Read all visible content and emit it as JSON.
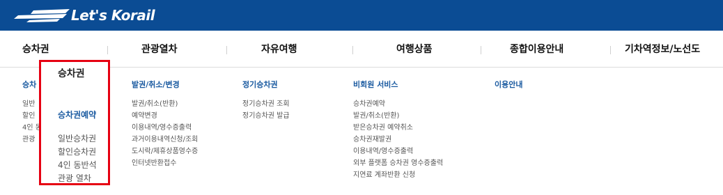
{
  "brand": {
    "logo_text": "Let's Korail",
    "bar_color": "#0b4c94"
  },
  "nav": {
    "items": [
      "승차권",
      "관광열차",
      "자유여행",
      "여행상품",
      "종합이용안내",
      "기차역정보/노선도"
    ]
  },
  "hidden_column": {
    "title": "승차",
    "items": [
      "일반",
      "할인",
      "4인 동",
      "관광"
    ]
  },
  "popup": {
    "heading": "승차권",
    "subtitle": "승차권예약",
    "items": [
      "일반승차권",
      "할인승차권",
      "4인 동반석",
      "관광 열차"
    ],
    "border_color": "#e60012"
  },
  "columns": [
    {
      "title": "발권/취소/변경",
      "items": [
        "발권/취소(반환)",
        "예약변경",
        "이용내역/영수증출력",
        "과거이용내역신청/조회",
        "도시락/제휴상품영수증",
        "인터넷반환접수"
      ]
    },
    {
      "title": "정기승차권",
      "items": [
        "정기승차권 조회",
        "정기승차권 발급"
      ]
    },
    {
      "title": "비회원 서비스",
      "items": [
        "승차권예약",
        "발권/취소(반환)",
        "받은승차권 예약취소",
        "승차권재발권",
        "이용내역/영수증출력",
        "외부 플랫폼 승차권 영수증출력",
        "지연료 계좌반환 신청"
      ]
    },
    {
      "title": "이용안내",
      "items": []
    }
  ]
}
